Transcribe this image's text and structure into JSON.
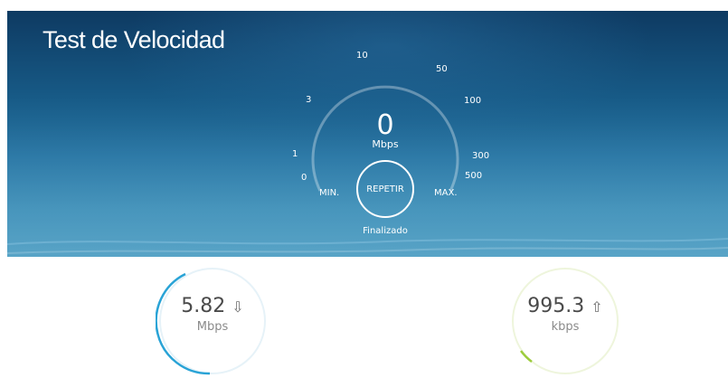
{
  "header": {
    "title": "Test de Velocidad"
  },
  "gauge": {
    "current_value": "0",
    "unit": "Mbps",
    "scale_labels": [
      "0",
      "1",
      "3",
      "10",
      "50",
      "100",
      "300",
      "500"
    ],
    "min_label": "MIN.",
    "max_label": "MAX.",
    "button_label": "REPETIR",
    "status": "Finalizado"
  },
  "results": {
    "download": {
      "value": "5.82",
      "unit": "Mbps",
      "arrow": "⇩",
      "accent": "#29a3d6"
    },
    "upload": {
      "value": "995.3",
      "unit": "kbps",
      "arrow": "⇧",
      "accent": "#9ccc3c"
    }
  }
}
